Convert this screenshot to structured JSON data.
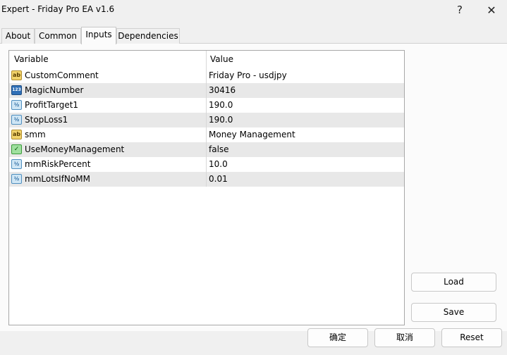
{
  "window": {
    "title": "Expert - Friday Pro EA v1.6",
    "help_glyph": "?",
    "close_glyph": "✕"
  },
  "tabs": [
    {
      "label": "About"
    },
    {
      "label": "Common"
    },
    {
      "label": "Inputs",
      "active": true
    },
    {
      "label": "Dependencies"
    }
  ],
  "grid": {
    "columns": [
      "Variable",
      "Value"
    ],
    "rows": [
      {
        "icon": "string-icon",
        "icon_text": "ab",
        "variable": "CustomComment",
        "value": "Friday Pro - usdjpy"
      },
      {
        "icon": "integer-icon",
        "icon_text": "123",
        "variable": "MagicNumber",
        "value": "30416"
      },
      {
        "icon": "double-icon",
        "icon_text": "½",
        "variable": "ProfitTarget1",
        "value": "190.0"
      },
      {
        "icon": "double-icon",
        "icon_text": "½",
        "variable": "StopLoss1",
        "value": "190.0"
      },
      {
        "icon": "string-icon",
        "icon_text": "ab",
        "variable": "smm",
        "value": "Money Management"
      },
      {
        "icon": "bool-icon",
        "icon_text": "✓",
        "variable": "UseMoneyManagement",
        "value": "false"
      },
      {
        "icon": "double-icon",
        "icon_text": "½",
        "variable": "mmRiskPercent",
        "value": "10.0"
      },
      {
        "icon": "double-icon",
        "icon_text": "½",
        "variable": "mmLotsIfNoMM",
        "value": "0.01"
      }
    ]
  },
  "side_buttons": {
    "load": "Load",
    "save": "Save"
  },
  "footer_buttons": {
    "ok": "确定",
    "cancel": "取消",
    "reset": "Reset"
  },
  "colors": {
    "accent": "#0067c0",
    "row_alt": "#e8e8e8"
  }
}
